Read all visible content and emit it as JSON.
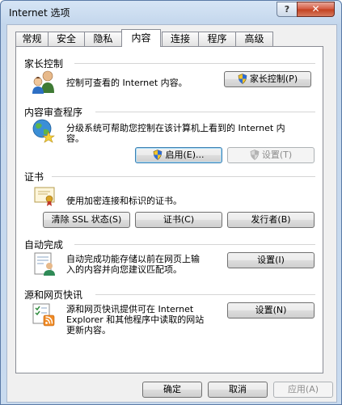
{
  "window": {
    "title": "Internet 选项",
    "help_label": "?",
    "close_label": "✕"
  },
  "tabs": [
    {
      "label": "常规"
    },
    {
      "label": "安全"
    },
    {
      "label": "隐私"
    },
    {
      "label": "内容",
      "active": true
    },
    {
      "label": "连接"
    },
    {
      "label": "程序"
    },
    {
      "label": "高级"
    }
  ],
  "parental": {
    "title": "家长控制",
    "description": "控制可查看的 Internet 内容。",
    "button": "家长控制(P)"
  },
  "advisor": {
    "title": "内容审查程序",
    "description_line1": "分级系统可帮助您控制在该计算机上看到的 Internet 内",
    "description_line2": "容。",
    "enable_button": "启用(E)...",
    "settings_button": "设置(T)"
  },
  "certificates": {
    "title": "证书",
    "description": "使用加密连接和标识的证书。",
    "clear_ssl_button": "清除 SSL 状态(S)",
    "certificates_button": "证书(C)",
    "publishers_button": "发行者(B)"
  },
  "autocomplete": {
    "title": "自动完成",
    "description_line1": "自动完成功能存储以前在网页上输",
    "description_line2": "入的内容并向您建议匹配项。",
    "settings_button": "设置(I)"
  },
  "feeds": {
    "title": "源和网页快讯",
    "description_line1": "源和网页快讯提供可在 Internet",
    "description_line2": "Explorer 和其他程序中读取的网站",
    "description_line3": "更新内容。",
    "settings_button": "设置(N)"
  },
  "footer": {
    "ok_button": "确定",
    "cancel_button": "取消",
    "apply_button": "应用(A)"
  },
  "colors": {
    "accent": "#3c7fb1",
    "close_red": "#c2401f",
    "disabled_text": "#8d8d8d"
  }
}
